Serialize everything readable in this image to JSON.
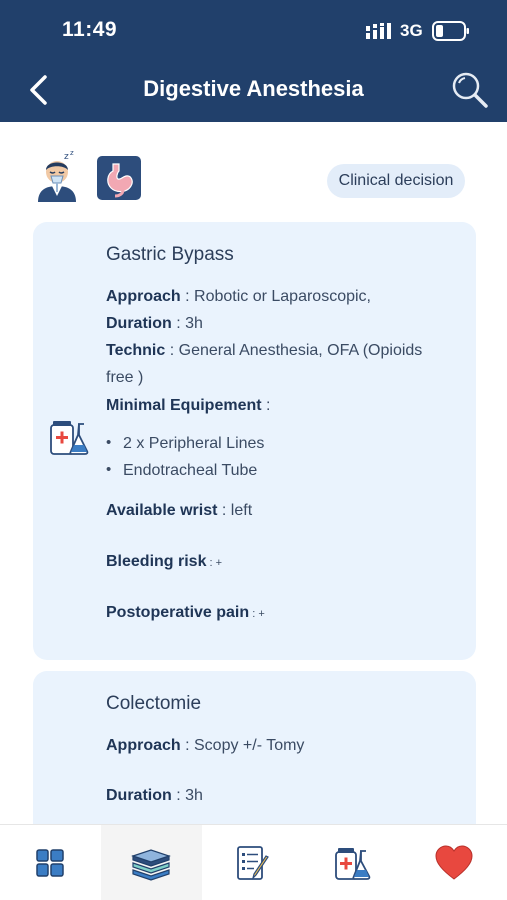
{
  "status_bar": {
    "time": "11:49",
    "network": "3G"
  },
  "nav": {
    "title": "Digestive Anesthesia"
  },
  "top": {
    "chip_label": "Clinical decision"
  },
  "cards": [
    {
      "title": "Gastric Bypass",
      "approach_label": "Approach",
      "approach_value": " : Robotic or Laparoscopic,",
      "duration_label": "Duration",
      "duration_value": " : 3h",
      "technic_label": "Technic",
      "technic_value": " : General Anesthesia, OFA (Opioids free )",
      "equipment_label": "Minimal Equipement",
      "equipment_suffix": " :",
      "equipment_items": [
        "2 x Peripheral Lines",
        "Endotracheal Tube"
      ],
      "wrist_label": "Available wrist",
      "wrist_value": " : left",
      "bleeding_label": "Bleeding risk",
      "bleeding_value": " : +",
      "pain_label": "Postoperative pain",
      "pain_value": " : +"
    },
    {
      "title": "Colectomie",
      "approach_label": "Approach",
      "approach_value": " : Scopy +/- Tomy",
      "duration_label": "Duration",
      "duration_value": " : 3h"
    }
  ],
  "tabbar": {
    "tabs": [
      {
        "icon": "grid-icon",
        "active": false
      },
      {
        "icon": "books-icon",
        "active": true
      },
      {
        "icon": "checklist-icon",
        "active": false
      },
      {
        "icon": "medicine-icon",
        "active": false
      },
      {
        "icon": "heart-icon",
        "active": false
      }
    ]
  },
  "colors": {
    "header": "#21406b",
    "card": "#eaf3fd",
    "chip": "#e3edf9",
    "heart": "#e8483f",
    "accent": "#3b7dc4"
  }
}
